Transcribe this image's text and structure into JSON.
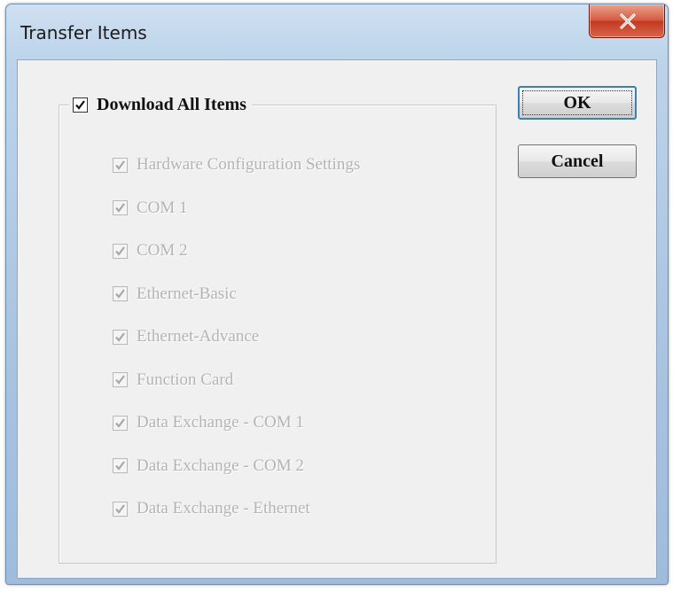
{
  "window": {
    "title": "Transfer Items",
    "close_icon": "close-x-icon"
  },
  "group": {
    "label": "Download All Items",
    "checked": true
  },
  "items": [
    {
      "label": "Hardware Configuration Settings",
      "checked": true,
      "enabled": false
    },
    {
      "label": "COM 1",
      "checked": true,
      "enabled": false
    },
    {
      "label": "COM 2",
      "checked": true,
      "enabled": false
    },
    {
      "label": "Ethernet-Basic",
      "checked": true,
      "enabled": false
    },
    {
      "label": "Ethernet-Advance",
      "checked": true,
      "enabled": false
    },
    {
      "label": "Function Card",
      "checked": true,
      "enabled": false
    },
    {
      "label": "Data Exchange - COM 1",
      "checked": true,
      "enabled": false
    },
    {
      "label": "Data Exchange - COM 2",
      "checked": true,
      "enabled": false
    },
    {
      "label": "Data Exchange - Ethernet",
      "checked": true,
      "enabled": false
    }
  ],
  "buttons": {
    "ok_label": "OK",
    "cancel_label": "Cancel"
  },
  "colors": {
    "close_button": "#c8452b",
    "disabled_text": "#b4b4b4"
  }
}
